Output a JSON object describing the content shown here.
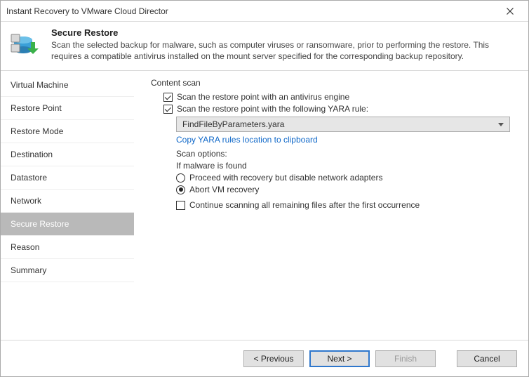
{
  "window": {
    "title": "Instant Recovery to VMware Cloud Director"
  },
  "banner": {
    "heading": "Secure Restore",
    "description": "Scan the selected backup for malware, such as computer viruses or ransomware, prior to performing the restore. This requires a compatible antivirus installed on the mount server specified for the corresponding backup repository."
  },
  "sidebar": {
    "items": [
      {
        "label": "Virtual Machine"
      },
      {
        "label": "Restore Point"
      },
      {
        "label": "Restore Mode"
      },
      {
        "label": "Destination"
      },
      {
        "label": "Datastore"
      },
      {
        "label": "Network"
      },
      {
        "label": "Secure Restore",
        "active": true
      },
      {
        "label": "Reason"
      },
      {
        "label": "Summary"
      }
    ]
  },
  "content": {
    "group_label": "Content scan",
    "scan_av": {
      "label": "Scan the restore point with an antivirus engine",
      "checked": true
    },
    "scan_yara": {
      "label": "Scan the restore point with the following YARA rule:",
      "checked": true
    },
    "yara_select": {
      "value": "FindFileByParameters.yara"
    },
    "copy_link": "Copy YARA rules location to clipboard",
    "scan_options_label": "Scan options:",
    "if_found_label": "If malware is found",
    "opt_proceed": {
      "label": "Proceed with recovery but disable network adapters",
      "selected": false
    },
    "opt_abort": {
      "label": "Abort VM recovery",
      "selected": true
    },
    "continue_scan": {
      "label": "Continue scanning all remaining files after the first occurrence",
      "checked": false
    }
  },
  "footer": {
    "previous": "< Previous",
    "next": "Next >",
    "finish": "Finish",
    "cancel": "Cancel"
  },
  "colors": {
    "link": "#1169c9",
    "primary_border": "#2f77cc",
    "sidebar_active": "#b9b9b9"
  }
}
